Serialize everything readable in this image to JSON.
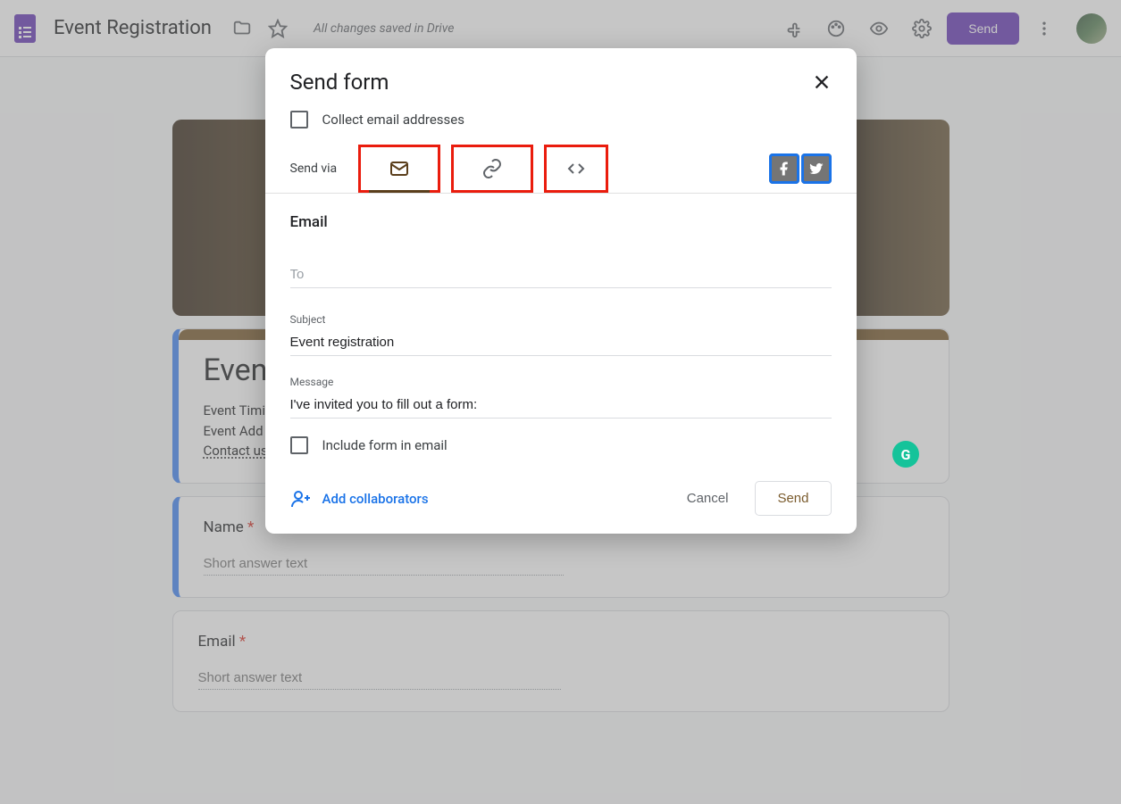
{
  "header": {
    "doc_title": "Event Registration",
    "saved_text": "All changes saved in Drive",
    "send_label": "Send"
  },
  "form": {
    "title": "Even",
    "desc1": "Event Timi",
    "desc2": "Event Add",
    "desc3": "Contact us",
    "q1_label": "Name",
    "q2_label": "Email",
    "short_answer_placeholder": "Short answer text"
  },
  "dialog": {
    "title": "Send form",
    "collect_label": "Collect email addresses",
    "send_via_label": "Send via",
    "section_title": "Email",
    "to_label": "To",
    "subject_label": "Subject",
    "subject_value": "Event registration",
    "message_label": "Message",
    "message_value": "I've invited you to fill out a form:",
    "include_label": "Include form in email",
    "add_collab": "Add collaborators",
    "cancel_label": "Cancel",
    "send_label": "Send"
  }
}
